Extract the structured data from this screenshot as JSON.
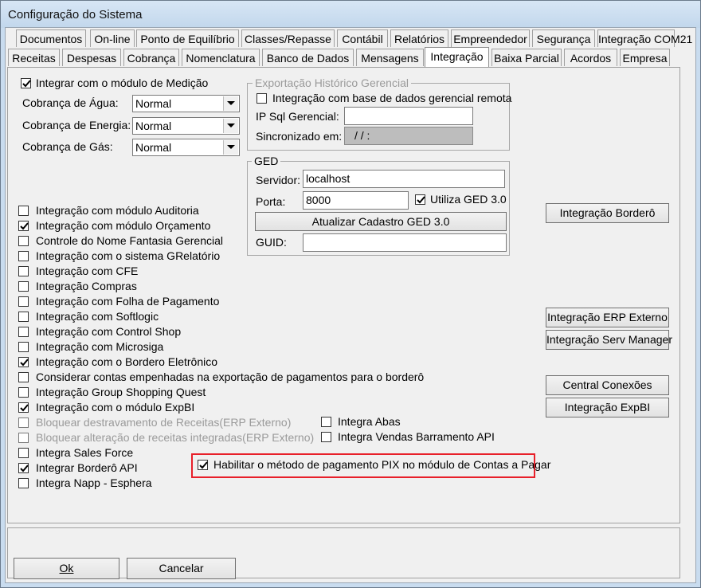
{
  "window": {
    "title": "Configuração do Sistema"
  },
  "tabs_row1": [
    "Documentos",
    "On-line",
    "Ponto de Equilíbrio",
    "Classes/Repasse",
    "Contábil",
    "Relatórios",
    "Empreendedor",
    "Segurança",
    "Integração COM21"
  ],
  "tabs_row2": [
    "Receitas",
    "Despesas",
    "Cobrança",
    "Nomenclatura",
    "Banco de Dados",
    "Mensagens",
    "Integração",
    "Baixa Parcial",
    "Acordos",
    "Empresa"
  ],
  "active_tab": "Integração",
  "medicao": {
    "checkbox_label": "Integrar com o módulo de Medição",
    "checked": true,
    "agua_label": "Cobrança de Água:",
    "agua_value": "Normal",
    "energia_label": "Cobrança de Energia:",
    "energia_value": "Normal",
    "gas_label": "Cobrança de Gás:",
    "gas_value": "Normal"
  },
  "exportacao": {
    "title": "Exportação Histórico Gerencial",
    "check_label": "Integração com base de dados gerencial remota",
    "checked": false,
    "ip_label": "IP Sql Gerencial:",
    "ip_value": "",
    "sync_label": "Sincronizado em:",
    "sync_value": "/ /        :"
  },
  "ged": {
    "title": "GED",
    "servidor_label": "Servidor:",
    "servidor_value": "localhost",
    "porta_label": "Porta:",
    "porta_value": "8000",
    "utiliza_label": "Utiliza GED 3.0",
    "utiliza_checked": true,
    "atualizar_button": "Atualizar Cadastro GED 3.0",
    "guid_label": "GUID:",
    "guid_value": ""
  },
  "integration_options": [
    {
      "label": "Integração com módulo Auditoria",
      "checked": false
    },
    {
      "label": "Integração com módulo Orçamento",
      "checked": true
    },
    {
      "label": "Controle do Nome Fantasia Gerencial",
      "checked": false
    },
    {
      "label": "Integração com o sistema GRelatório",
      "checked": false
    },
    {
      "label": "Integração com CFE",
      "checked": false
    },
    {
      "label": "Integração Compras",
      "checked": false
    },
    {
      "label": "Integração com Folha de Pagamento",
      "checked": false
    },
    {
      "label": "Integração com Softlogic",
      "checked": false
    },
    {
      "label": "Integração com Control Shop",
      "checked": false
    },
    {
      "label": "Integração com Microsiga",
      "checked": false
    },
    {
      "label": "Integração com o Bordero Eletrônico",
      "checked": true
    },
    {
      "label": "Considerar contas empenhadas na exportação de pagamentos para o borderô",
      "checked": false
    },
    {
      "label": "Integração Group Shopping Quest",
      "checked": false
    },
    {
      "label": "Integração com o módulo ExpBI",
      "checked": true
    },
    {
      "label": "Bloquear destravamento de Receitas(ERP Externo)",
      "checked": false,
      "disabled": true
    },
    {
      "label": "Bloquear alteração de receitas integradas(ERP Externo)",
      "checked": false,
      "disabled": true
    },
    {
      "label": "Integra Sales Force",
      "checked": false
    },
    {
      "label": "Integrar Borderô API",
      "checked": true
    },
    {
      "label": "Integra Napp - Esphera",
      "checked": false
    }
  ],
  "right_options": [
    {
      "label": "Integra Abas",
      "checked": false
    },
    {
      "label": "Integra Vendas Barramento API",
      "checked": false
    }
  ],
  "pix_option": {
    "label": "Habilitar o método de pagamento PIX no módulo de Contas a Pagar",
    "checked": true
  },
  "side_buttons": {
    "bordero": "Integração Borderô",
    "erp": "Integração ERP Externo",
    "serv_manager": "Integração Serv Manager",
    "central": "Central Conexões",
    "expbi": "Integração ExpBI"
  },
  "footer": {
    "ok": "Ok",
    "cancel": "Cancelar"
  },
  "colors": {
    "highlight": "#e8202a",
    "title_bar": "#c9dcef"
  }
}
